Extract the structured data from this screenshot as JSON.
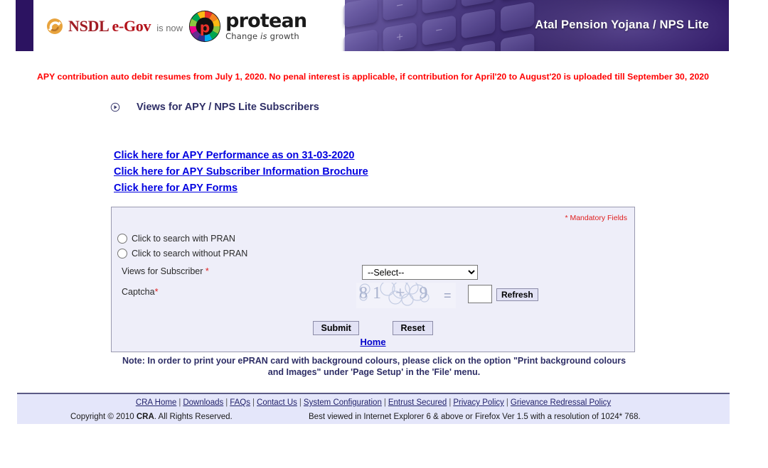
{
  "header": {
    "nsdl_logo_text": "NSDL",
    "nsdl_logo_egov": "e-Gov",
    "is_now_text": "is now",
    "protean_name": "protean",
    "protean_tagline_part1": "Change ",
    "protean_tagline_italic": "is",
    "protean_tagline_part2": " growth",
    "banner_title": "Atal Pension Yojana / NPS Lite",
    "banner_bg_color": "#2b1360",
    "calculator_keys": [
      "−",
      "×",
      "",
      "",
      "",
      "+",
      "−",
      "",
      "",
      "",
      "",
      "",
      "",
      "",
      ""
    ]
  },
  "notice": {
    "text": "APY contribution auto debit resumes from July 1, 2020. No penal interest is applicable, if contribution for April'20 to August'20 is uploaded till September 30, 2020",
    "color": "#ff0000"
  },
  "section": {
    "bullet_icon": "circled-play-icon",
    "title": "Views for APY / NPS Lite Subscribers"
  },
  "links": [
    {
      "label": "Click here for APY Performance as on 31-03-2020"
    },
    {
      "label": "Click here for APY Subscriber Information Brochure"
    },
    {
      "label": "Click here for APY Forms"
    }
  ],
  "form": {
    "mandatory_note": "* Mandatory Fields",
    "radio_with_pran": "Click to search with PRAN",
    "radio_without_pran": "Click to search without PRAN",
    "views_label": "Views for Subscriber ",
    "views_required_mark": "*",
    "views_selected": "--Select--",
    "views_options": [
      "--Select--"
    ],
    "captcha_label": "Captcha",
    "captcha_required_mark": "*",
    "captcha_challenge": "81 + 9",
    "captcha_equals": "=",
    "captcha_value": "",
    "refresh_label": "Refresh",
    "submit_label": "Submit",
    "reset_label": "Reset",
    "home_label": "Home",
    "panel_bg_color": "#eeeef9"
  },
  "note": {
    "line1": "Note: In order to print your ePRAN card with background colours, please click on the option \"Print background",
    "line2": "colours and Images\" under 'Page Setup' in the 'File' menu."
  },
  "footer": {
    "links": [
      "CRA Home",
      "Downloads",
      "FAQs",
      "Contact Us",
      "System Configuration",
      "Entrust Secured",
      "Privacy Policy",
      "Grievance Redressal Policy"
    ],
    "separator": "|",
    "copyright_pre": "Copyright © 2010 ",
    "copyright_bold": "CRA",
    "copyright_post": ". All Rights Reserved.",
    "best_viewed": "Best viewed in Internet Explorer 6 & above or Firefox Ver 1.5 with a resolution of 1024* 768.",
    "bg_color": "#e4e6fa"
  }
}
